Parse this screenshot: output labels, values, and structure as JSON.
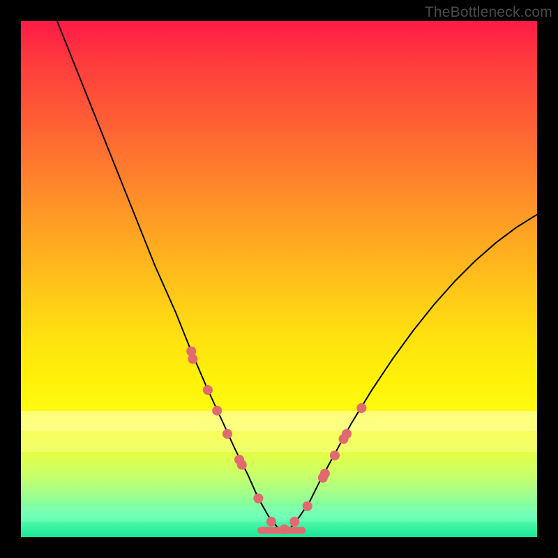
{
  "watermark": "TheBottleneck.com",
  "chart_data": {
    "type": "line",
    "title": "",
    "xlabel": "",
    "ylabel": "",
    "xlim": [
      0,
      100
    ],
    "ylim": [
      0,
      100
    ],
    "grid": false,
    "legend": false,
    "series": [
      {
        "name": "curve",
        "color": "#000000",
        "x": [
          7,
          10,
          14,
          18,
          22,
          26,
          30,
          33,
          36,
          39,
          41.5,
          44,
          46,
          48,
          50,
          52,
          54,
          56,
          58,
          61,
          64,
          68,
          72,
          76,
          80,
          84,
          88,
          92,
          96,
          100
        ],
        "values": [
          100,
          92.5,
          82.5,
          72.5,
          62.5,
          52.5,
          43.5,
          36.0,
          29.0,
          22.5,
          17.0,
          12.0,
          7.5,
          4.0,
          1.5,
          1.5,
          4.0,
          7.0,
          11.0,
          16.5,
          22.0,
          28.5,
          34.5,
          40.0,
          45.0,
          49.5,
          53.5,
          57.0,
          60.0,
          62.5
        ]
      }
    ],
    "markers": {
      "name": "dots",
      "color": "#e06a6f",
      "x": [
        33.0,
        33.3,
        36.2,
        38.0,
        40.0,
        42.3,
        42.8,
        46.0,
        48.5,
        51.0,
        53.0,
        55.5,
        58.5,
        58.9,
        60.8,
        62.5,
        63.1,
        66.0
      ],
      "values": [
        36.0,
        34.5,
        28.5,
        24.5,
        20.0,
        15.0,
        14.0,
        7.5,
        3.0,
        1.5,
        3.0,
        6.0,
        11.5,
        12.3,
        15.8,
        19.0,
        20.0,
        25.0
      ]
    },
    "flat_segment": {
      "name": "trough",
      "color": "#e06a6f",
      "x_start": 46.5,
      "x_end": 54.5,
      "y": 1.3
    }
  }
}
